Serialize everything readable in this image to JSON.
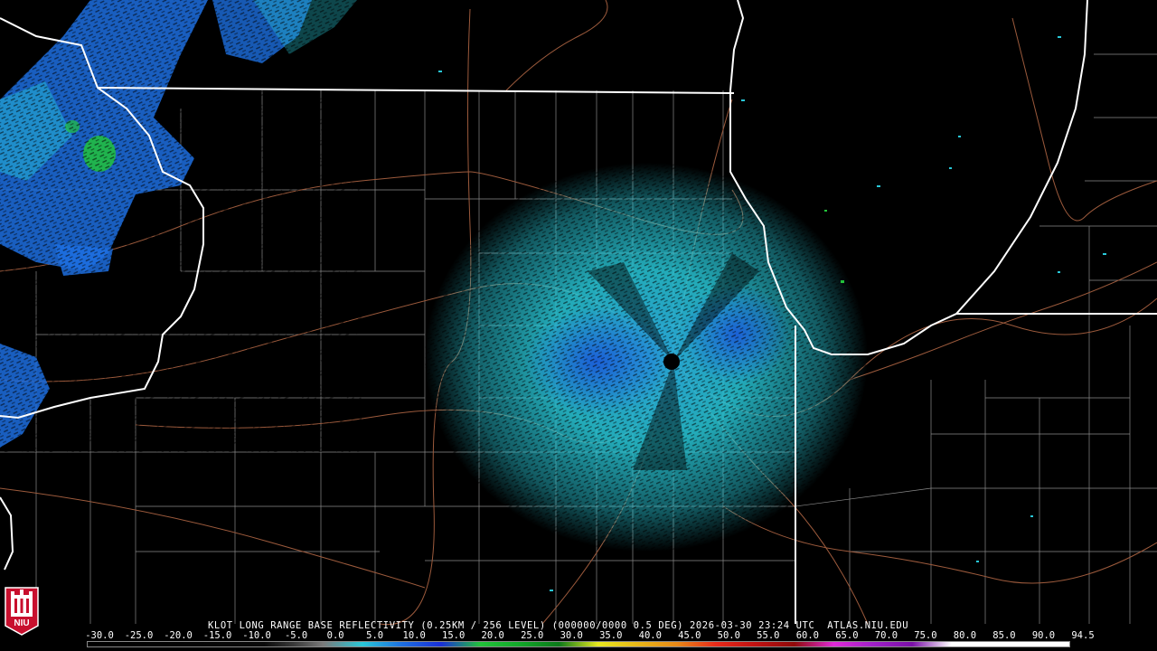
{
  "caption": "KLOT LONG RANGE BASE REFLECTIVITY (0.25KM / 256 LEVEL) (000000/0000 0.5 DEG) 2026-03-30 23:24 UTC  ATLAS.NIU.EDU",
  "logo_text": "NIU",
  "scale": {
    "ticks": [
      "-30.0",
      "-25.0",
      "-20.0",
      "-15.0",
      "-10.0",
      "-5.0",
      "0.0",
      "5.0",
      "10.0",
      "15.0",
      "20.0",
      "25.0",
      "30.0",
      "35.0",
      "40.0",
      "45.0",
      "50.0",
      "55.0",
      "60.0",
      "65.0",
      "70.0",
      "75.0",
      "80.0",
      "85.0",
      "90.0",
      "94.5"
    ],
    "colors": {
      "background": "#000000",
      "state_border": "#ffffff",
      "county_line": "#8a8a8a",
      "highway": "#9c5a3c",
      "echo_light": "#29c8d8",
      "echo_medium": "#1d6fe0",
      "echo_strong": "#22c23a",
      "logo": "#c8102e"
    }
  }
}
